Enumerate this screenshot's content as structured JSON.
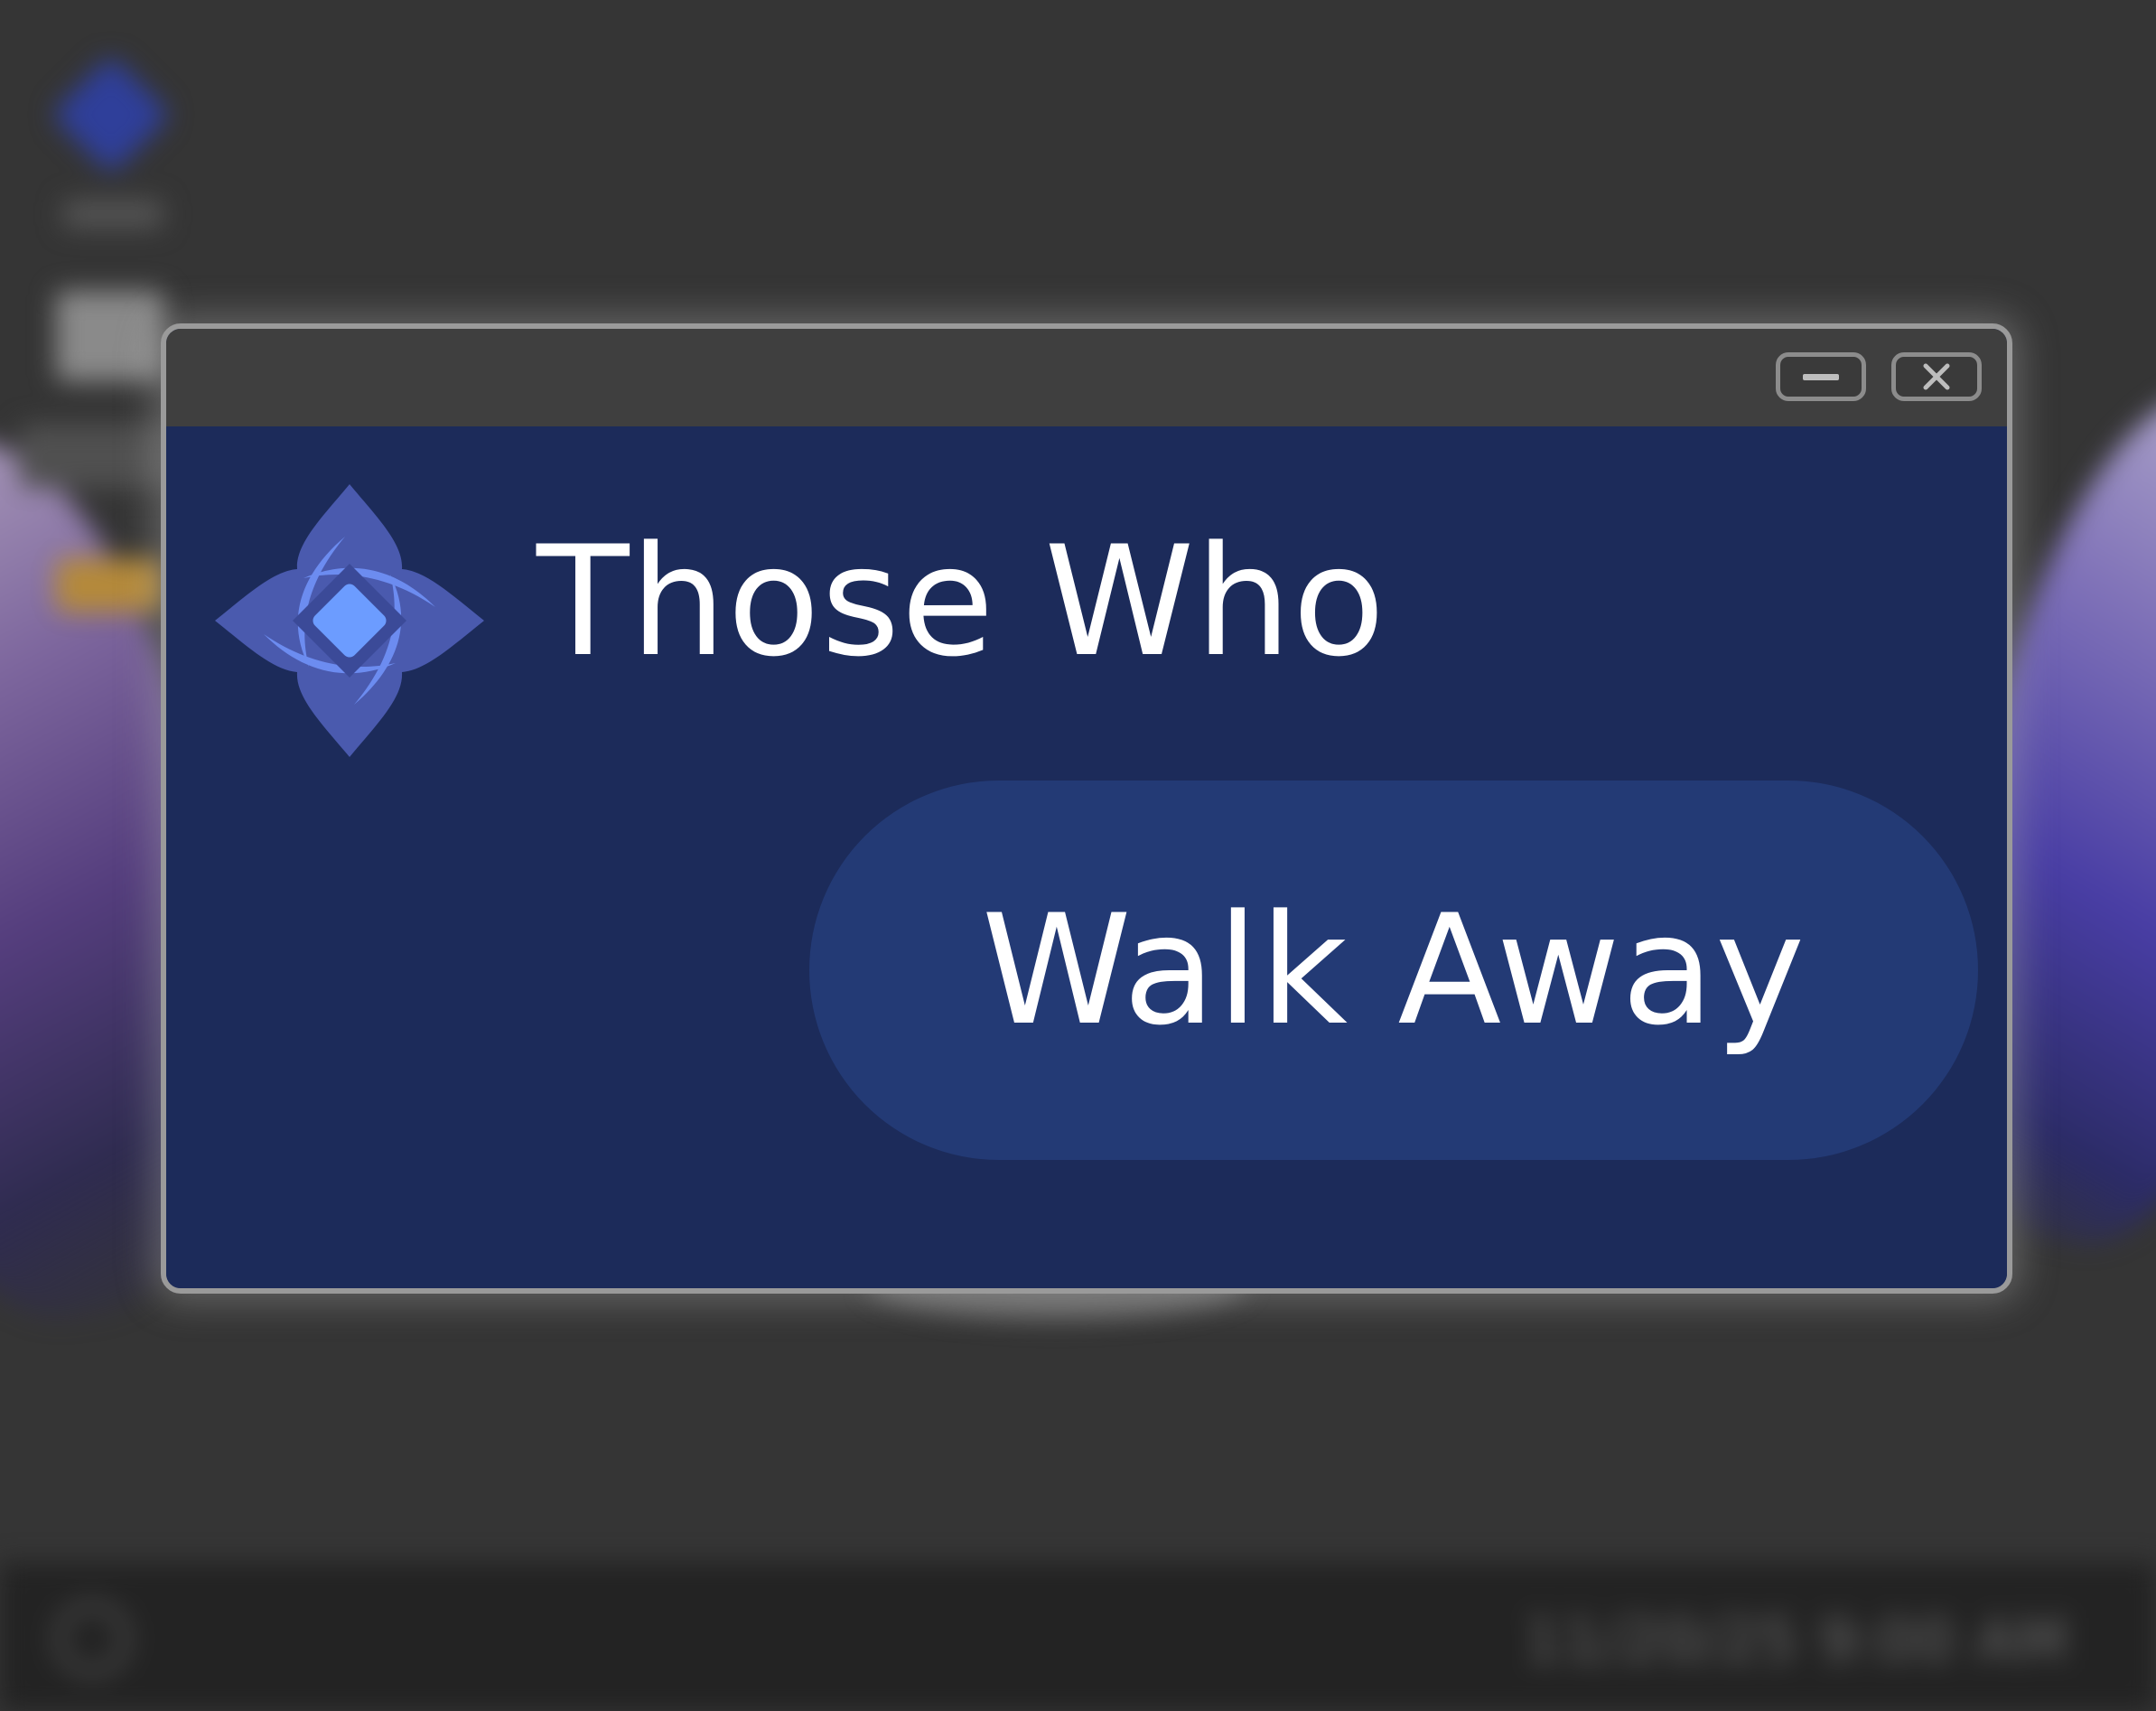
{
  "window": {
    "heading": "Those Who",
    "primary_button_label": "Walk Away",
    "minimize_icon": "minus-icon",
    "close_icon": "close-x-icon"
  },
  "taskbar": {
    "clock": "11/20/25  9:00 AM",
    "power_icon": "power-icon"
  },
  "colors": {
    "window_bg": "#1c2b5a",
    "pill_bg": "#233a75",
    "titlebar_bg": "#3f3f3f",
    "logo_outer": "#4a5aae",
    "logo_accent": "#6c8cf0",
    "logo_center": "#6c9cff"
  }
}
